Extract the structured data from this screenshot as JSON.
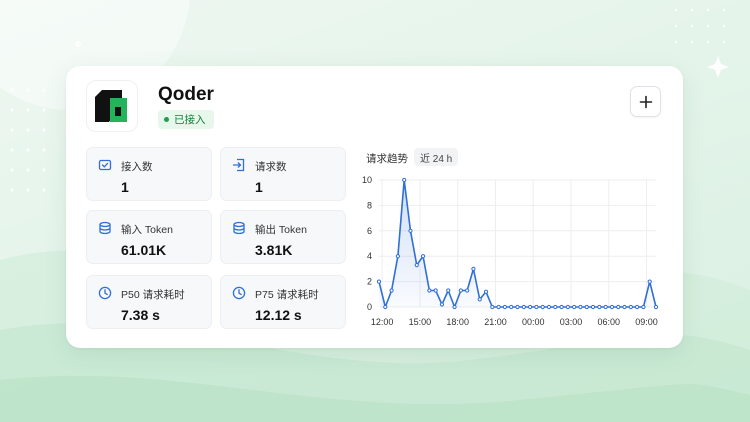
{
  "app": {
    "name": "Qoder",
    "status": "已接入"
  },
  "stats": [
    {
      "label": "接入数",
      "value": "1",
      "icon": "plug-in-icon"
    },
    {
      "label": "请求数",
      "value": "1",
      "icon": "request-icon"
    },
    {
      "label": "输入 Token",
      "value": "61.01K",
      "icon": "database-icon"
    },
    {
      "label": "输出 Token",
      "value": "3.81K",
      "icon": "database-icon"
    },
    {
      "label": "P50 请求耗时",
      "value": "7.38 s",
      "icon": "clock-icon"
    },
    {
      "label": "P75 请求耗时",
      "value": "12.12 s",
      "icon": "clock-icon"
    }
  ],
  "chart": {
    "title": "请求趋势",
    "range": "近 24 h"
  },
  "colors": {
    "accent": "#2f6fd6",
    "brand": "#24b35a",
    "status": "#1f9d4b"
  },
  "chart_data": {
    "type": "area",
    "title": "",
    "xlabel": "",
    "ylabel": "",
    "ylim": [
      0,
      10
    ],
    "yticks": [
      0,
      2,
      4,
      6,
      8,
      10
    ],
    "xticks": [
      "12:00",
      "15:00",
      "18:00",
      "21:00",
      "00:00",
      "03:00",
      "06:00",
      "09:00"
    ],
    "grid": true,
    "x": [
      "11:45",
      "12:15",
      "12:45",
      "13:15",
      "13:45",
      "14:15",
      "14:45",
      "15:15",
      "15:45",
      "16:15",
      "16:45",
      "17:15",
      "17:45",
      "18:15",
      "18:45",
      "19:15",
      "19:45",
      "20:15",
      "20:45",
      "21:15",
      "21:45",
      "22:15",
      "22:45",
      "23:15",
      "23:45",
      "00:15",
      "00:45",
      "01:15",
      "01:45",
      "02:15",
      "02:45",
      "03:15",
      "03:45",
      "04:15",
      "04:45",
      "05:15",
      "05:45",
      "06:15",
      "06:45",
      "07:15",
      "07:45",
      "08:15",
      "08:45",
      "09:15",
      "09:45"
    ],
    "series": [
      {
        "values": [
          2,
          0,
          1.3,
          4,
          10,
          6,
          3.3,
          4,
          1.3,
          1.3,
          0.2,
          1.3,
          0,
          1.3,
          1.3,
          3,
          0.6,
          1.2,
          0,
          0,
          0,
          0,
          0,
          0,
          0,
          0,
          0,
          0,
          0,
          0,
          0,
          0,
          0,
          0,
          0,
          0,
          0,
          0,
          0,
          0,
          0,
          0,
          0,
          2,
          0
        ]
      }
    ]
  }
}
